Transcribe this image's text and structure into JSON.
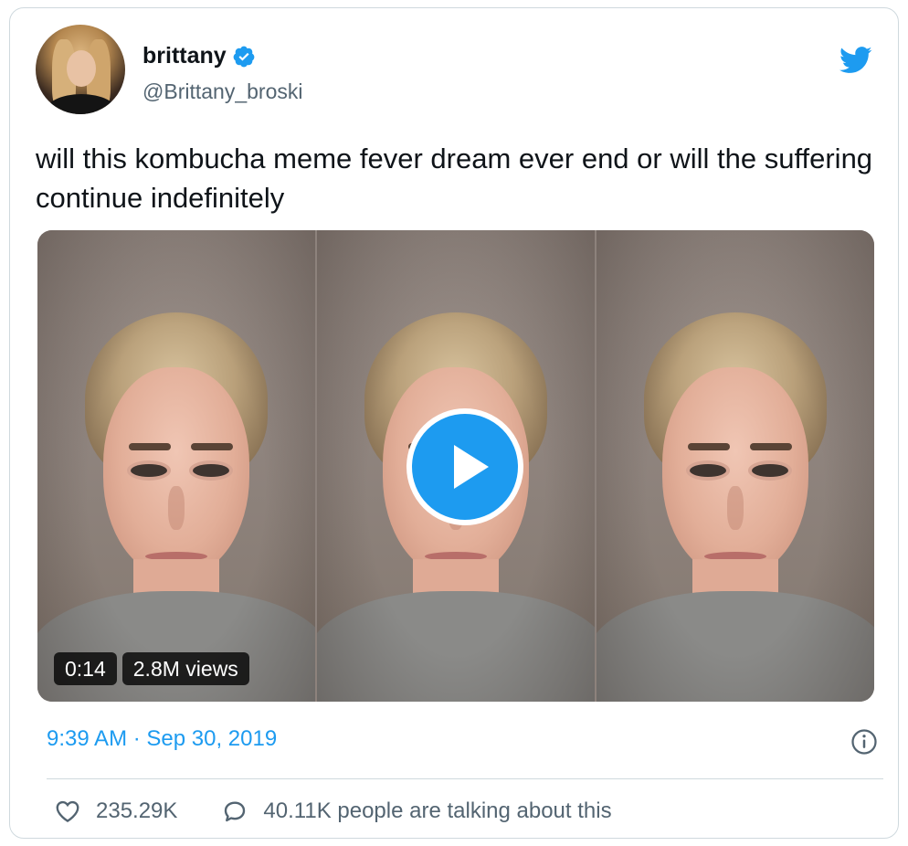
{
  "author": {
    "name": "brittany",
    "handle": "@Brittany_broski",
    "verified": true
  },
  "tweet": {
    "text": "will this kombucha meme fever dream ever end or will the suffering continue indefinitely",
    "timestamp": "9:39 AM · Sep 30, 2019"
  },
  "video": {
    "duration": "0:14",
    "views": "2.8M views"
  },
  "engagement": {
    "likes": "235.29K",
    "conversation": "40.11K people are talking about this"
  },
  "icons": {
    "brand": "twitter-bird-icon",
    "verified": "verified-badge-icon",
    "play": "play-icon",
    "info": "info-icon",
    "like": "heart-icon",
    "reply": "speech-bubble-icon"
  },
  "colors": {
    "accent": "#1d9bf0",
    "text": "#0f1419",
    "secondary": "#536471",
    "border": "#cfd9de"
  }
}
